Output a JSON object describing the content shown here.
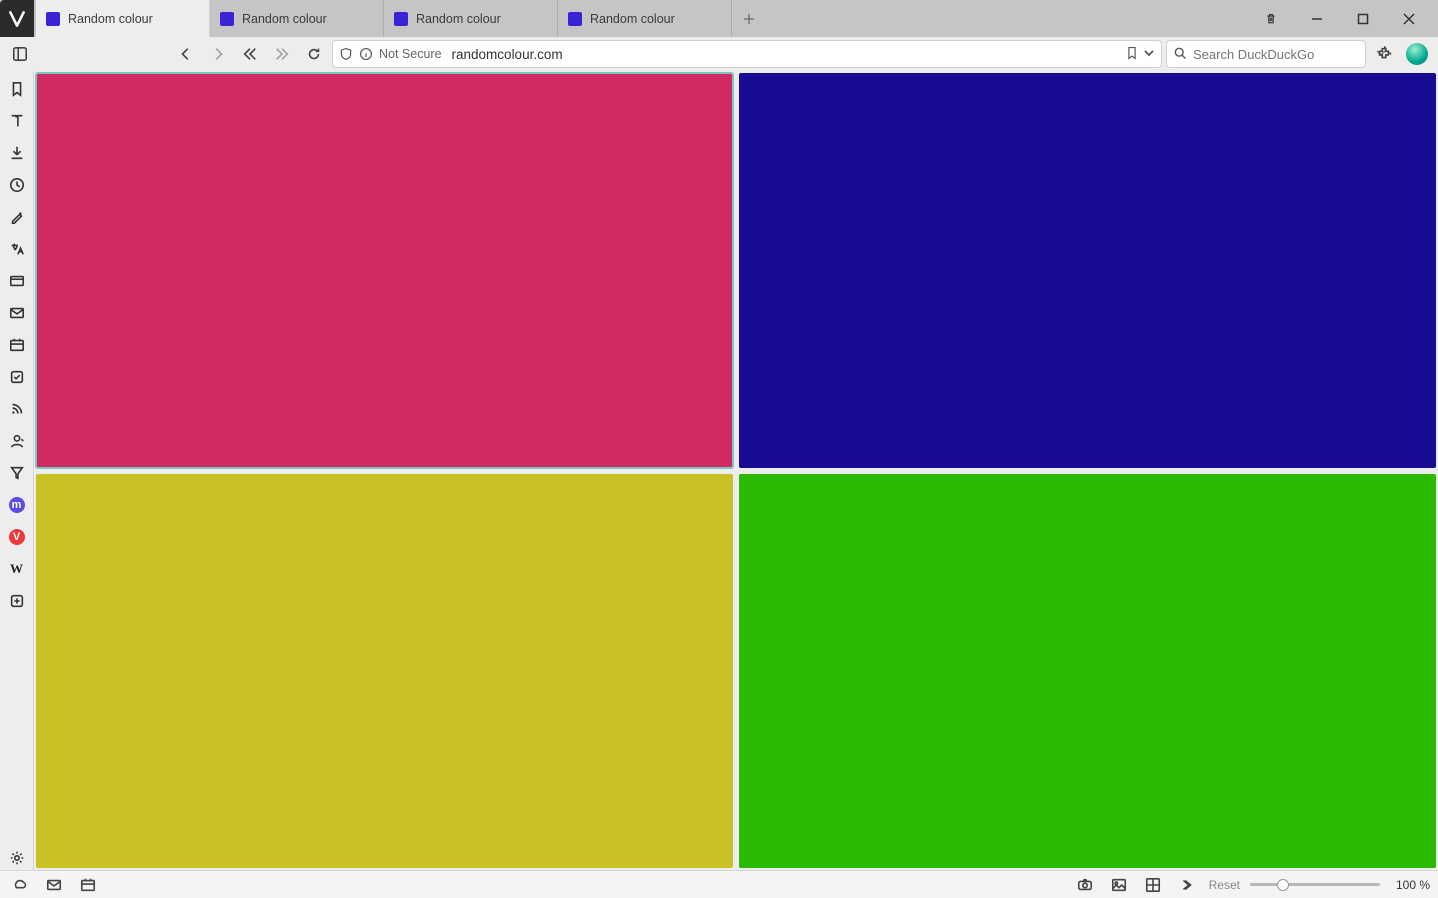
{
  "tabs": [
    {
      "title": "Random colour",
      "favicon": "#3a22d6",
      "active": true
    },
    {
      "title": "Random colour",
      "favicon": "#3a22d6",
      "active": false
    },
    {
      "title": "Random colour",
      "favicon": "#3a22d6",
      "active": false
    },
    {
      "title": "Random colour",
      "favicon": "#3a22d6",
      "active": false
    }
  ],
  "address": {
    "not_secure": "Not Secure",
    "url": "randomcolour.com"
  },
  "search": {
    "placeholder": "Search DuckDuckGo"
  },
  "tiles": [
    {
      "color": "#d12a63",
      "active": true
    },
    {
      "color": "#170b94",
      "active": false
    },
    {
      "color": "#c9c226",
      "active": false
    },
    {
      "color": "#28bb00",
      "active": false
    }
  ],
  "statusbar": {
    "reset": "Reset",
    "zoom": "100 %"
  },
  "panel_icons": {
    "mastodon_bg": "#5b4be0",
    "vivaldi_bg": "#ef3939"
  }
}
